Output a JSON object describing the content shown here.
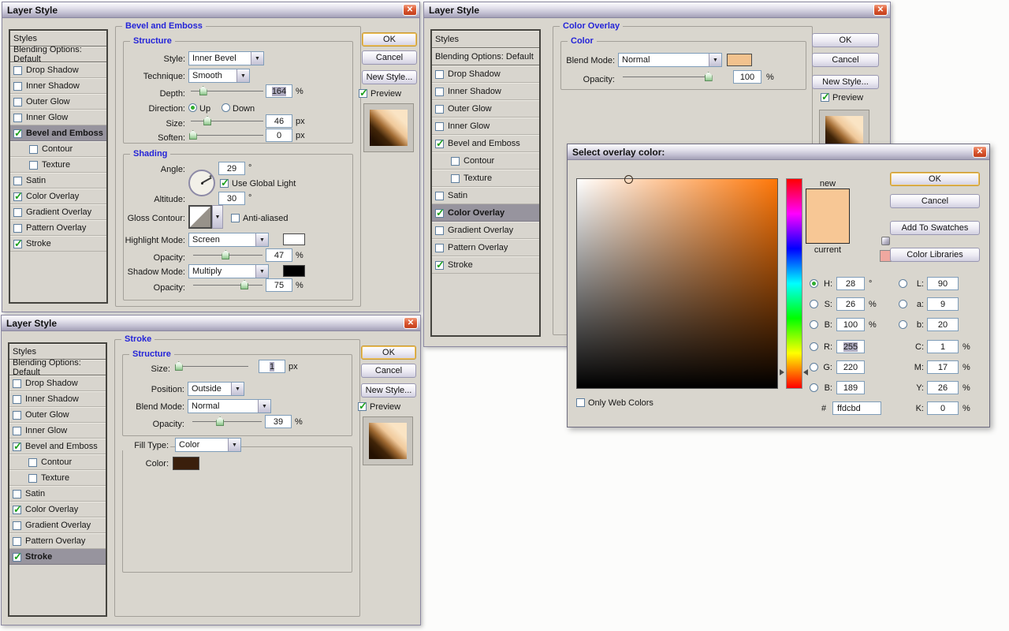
{
  "icons": {
    "close": "✕",
    "chevron_down": "▼",
    "global_light_star": "✦"
  },
  "colors": {
    "accent_blue": "#2424d8",
    "overlay_new": "#f7c795",
    "overlay_current": "#f7c795",
    "websafe_swatch": "#f0a8a0",
    "stroke_color": "#3a1f0c",
    "blend_swatch": "#f2c28e",
    "highlight_swatch": "#ffffff",
    "shadow_swatch": "#000000"
  },
  "dialogs": {
    "bevel": {
      "title": "Layer Style",
      "styles": [
        {
          "l": "Styles"
        },
        {
          "l": "Blending Options: Default"
        },
        {
          "l": "Drop Shadow",
          "cb": true,
          "on": false
        },
        {
          "l": "Inner Shadow",
          "cb": true,
          "on": false
        },
        {
          "l": "Outer Glow",
          "cb": true,
          "on": false
        },
        {
          "l": "Inner Glow",
          "cb": true,
          "on": false
        },
        {
          "l": "Bevel and Emboss",
          "cb": true,
          "on": true,
          "sel": true
        },
        {
          "l": "Contour",
          "cb": true,
          "on": false
        },
        {
          "l": "Texture",
          "cb": true,
          "on": false
        },
        {
          "l": "Satin",
          "cb": true,
          "on": false
        },
        {
          "l": "Color Overlay",
          "cb": true,
          "on": true
        },
        {
          "l": "Gradient Overlay",
          "cb": true,
          "on": false
        },
        {
          "l": "Pattern Overlay",
          "cb": true,
          "on": false
        },
        {
          "l": "Stroke",
          "cb": true,
          "on": true
        }
      ],
      "panel_title": "Bevel and Emboss",
      "structure": {
        "label": "Structure",
        "style_label": "Style:",
        "style_value": "Inner Bevel",
        "technique_label": "Technique:",
        "technique_value": "Smooth",
        "depth_label": "Depth:",
        "depth_value": "164",
        "depth_unit": "%",
        "depth_selected": true,
        "direction_label": "Direction:",
        "up_label": "Up",
        "down_label": "Down",
        "up_selected": true,
        "size_label": "Size:",
        "size_value": "46",
        "size_unit": "px",
        "soften_label": "Soften:",
        "soften_value": "0",
        "soften_unit": "px"
      },
      "shading": {
        "label": "Shading",
        "angle_label": "Angle:",
        "angle_value": "29",
        "deg": "°",
        "use_global_light": "Use Global Light",
        "ugl_checked": true,
        "altitude_label": "Altitude:",
        "altitude_value": "30",
        "gloss_label": "Gloss Contour:",
        "anti_aliased": "Anti-aliased",
        "aa_checked": false,
        "highlight_label": "Highlight Mode:",
        "highlight_value": "Screen",
        "opacity_label": "Opacity:",
        "highlight_opacity": "47",
        "pct": "%",
        "shadow_label": "Shadow Mode:",
        "shadow_value": "Multiply",
        "shadow_opacity": "75"
      },
      "buttons": {
        "ok": "OK",
        "cancel": "Cancel",
        "new_style": "New Style...",
        "preview": "Preview",
        "preview_checked": true
      }
    },
    "stroke": {
      "title": "Layer Style",
      "styles": [
        {
          "l": "Styles"
        },
        {
          "l": "Blending Options: Default"
        },
        {
          "l": "Drop Shadow",
          "cb": true,
          "on": false
        },
        {
          "l": "Inner Shadow",
          "cb": true,
          "on": false
        },
        {
          "l": "Outer Glow",
          "cb": true,
          "on": false
        },
        {
          "l": "Inner Glow",
          "cb": true,
          "on": false
        },
        {
          "l": "Bevel and Emboss",
          "cb": true,
          "on": true
        },
        {
          "l": "Contour",
          "cb": true,
          "on": false
        },
        {
          "l": "Texture",
          "cb": true,
          "on": false
        },
        {
          "l": "Satin",
          "cb": true,
          "on": false
        },
        {
          "l": "Color Overlay",
          "cb": true,
          "on": true
        },
        {
          "l": "Gradient Overlay",
          "cb": true,
          "on": false
        },
        {
          "l": "Pattern Overlay",
          "cb": true,
          "on": false
        },
        {
          "l": "Stroke",
          "cb": true,
          "on": true,
          "sel": true
        }
      ],
      "panel_title": "Stroke",
      "structure": {
        "label": "Structure",
        "size_label": "Size:",
        "size_value": "1",
        "size_unit": "px",
        "size_selected": true,
        "position_label": "Position:",
        "position_value": "Outside",
        "blend_label": "Blend Mode:",
        "blend_value": "Normal",
        "opacity_label": "Opacity:",
        "opacity_value": "39",
        "pct": "%"
      },
      "fill": {
        "fill_label": "Fill Type:",
        "fill_value": "Color",
        "color_label": "Color:"
      },
      "buttons": {
        "ok": "OK",
        "cancel": "Cancel",
        "new_style": "New Style...",
        "preview": "Preview",
        "preview_checked": true
      }
    },
    "overlay": {
      "title": "Layer Style",
      "styles": [
        {
          "l": "Styles"
        },
        {
          "l": "Blending Options: Default"
        },
        {
          "l": "Drop Shadow",
          "cb": true,
          "on": false
        },
        {
          "l": "Inner Shadow",
          "cb": true,
          "on": false
        },
        {
          "l": "Outer Glow",
          "cb": true,
          "on": false
        },
        {
          "l": "Inner Glow",
          "cb": true,
          "on": false
        },
        {
          "l": "Bevel and Emboss",
          "cb": true,
          "on": true
        },
        {
          "l": "Contour",
          "cb": true,
          "on": false
        },
        {
          "l": "Texture",
          "cb": true,
          "on": false
        },
        {
          "l": "Satin",
          "cb": true,
          "on": false
        },
        {
          "l": "Color Overlay",
          "cb": true,
          "on": true,
          "sel": true
        },
        {
          "l": "Gradient Overlay",
          "cb": true,
          "on": false
        },
        {
          "l": "Pattern Overlay",
          "cb": true,
          "on": false
        },
        {
          "l": "Stroke",
          "cb": true,
          "on": true
        }
      ],
      "panel_title": "Color Overlay",
      "color": {
        "label": "Color",
        "blend_label": "Blend Mode:",
        "blend_value": "Normal",
        "opacity_label": "Opacity:",
        "opacity_value": "100",
        "pct": "%"
      },
      "buttons": {
        "ok": "OK",
        "cancel": "Cancel",
        "new_style": "New Style...",
        "preview": "Preview",
        "preview_checked": true
      }
    }
  },
  "picker": {
    "title": "Select overlay color:",
    "new_label": "new",
    "current_label": "current",
    "only_web": "Only Web Colors",
    "only_web_checked": false,
    "buttons": {
      "ok": "OK",
      "cancel": "Cancel",
      "add": "Add To Swatches",
      "libraries": "Color Libraries"
    },
    "hsb": {
      "h_label": "H:",
      "h_value": "28",
      "h_unit": "°",
      "h_selected_radio": true,
      "s_label": "S:",
      "s_value": "26",
      "s_unit": "%",
      "b_label": "B:",
      "b_value": "100",
      "b_unit": "%"
    },
    "rgb": {
      "r_label": "R:",
      "r_value": "255",
      "r_selected": true,
      "g_label": "G:",
      "g_value": "220",
      "b_label": "B:",
      "b_value": "189"
    },
    "hex_label": "#",
    "hex_value": "ffdcbd",
    "lab": {
      "l_label": "L:",
      "l_value": "90",
      "a_label": "a:",
      "a_value": "9",
      "b_label": "b:",
      "b_value": "20"
    },
    "cmyk": {
      "c_label": "C:",
      "c_value": "1",
      "m_label": "M:",
      "m_value": "17",
      "y_label": "Y:",
      "y_value": "26",
      "k_label": "K:",
      "k_value": "0",
      "pct": "%"
    }
  }
}
